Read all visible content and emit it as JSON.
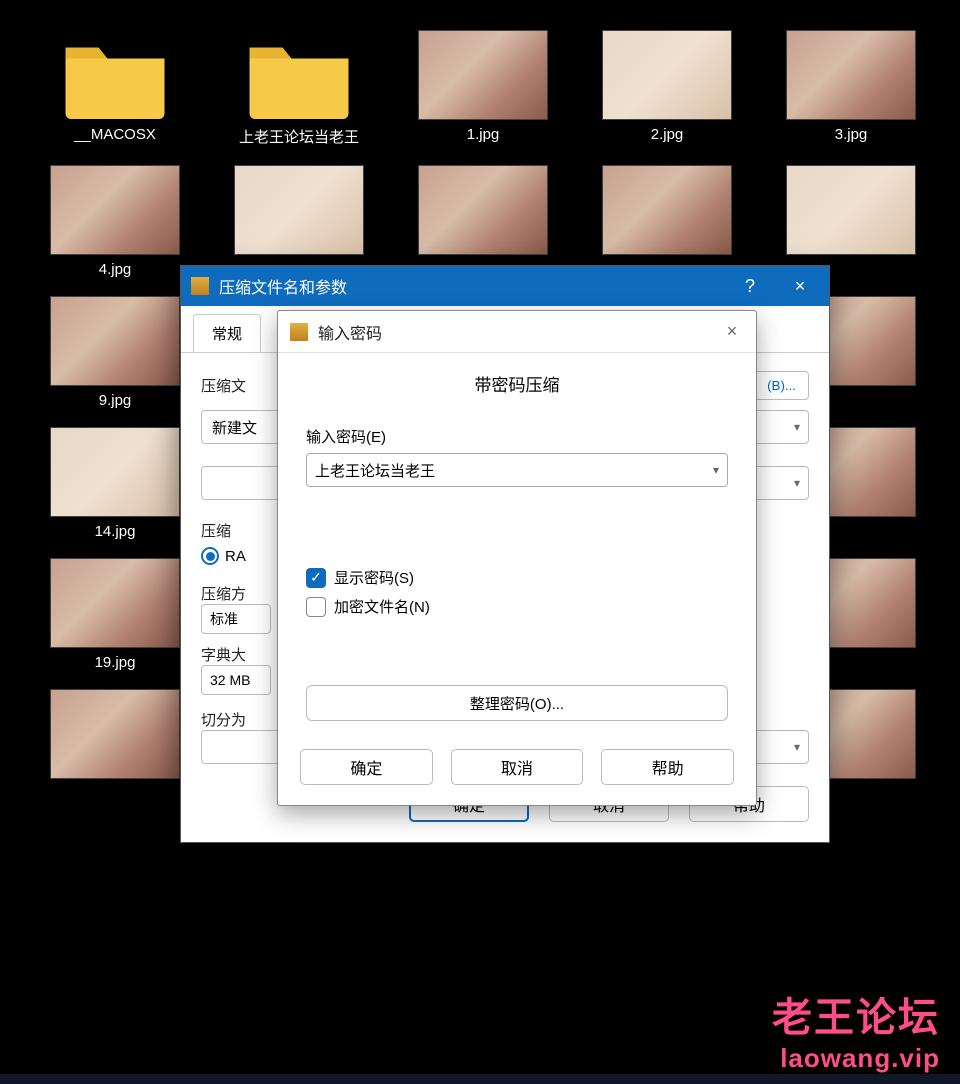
{
  "files": [
    {
      "name": "__MACOSX",
      "type": "folder"
    },
    {
      "name": "上老王论坛当老王",
      "type": "folder"
    },
    {
      "name": "1.jpg",
      "type": "image"
    },
    {
      "name": "2.jpg",
      "type": "image"
    },
    {
      "name": "3.jpg",
      "type": "image"
    },
    {
      "name": "4.jpg",
      "type": "image"
    },
    {
      "name": "",
      "type": "image"
    },
    {
      "name": "",
      "type": "image"
    },
    {
      "name": "",
      "type": "image"
    },
    {
      "name": "",
      "type": "image"
    },
    {
      "name": "9.jpg",
      "type": "image"
    },
    {
      "name": "",
      "type": "image"
    },
    {
      "name": "",
      "type": "image"
    },
    {
      "name": "",
      "type": "image"
    },
    {
      "name": "",
      "type": "image"
    },
    {
      "name": "14.jpg",
      "type": "image"
    },
    {
      "name": "",
      "type": "image"
    },
    {
      "name": "",
      "type": "image"
    },
    {
      "name": "",
      "type": "image"
    },
    {
      "name": "",
      "type": "image"
    },
    {
      "name": "19.jpg",
      "type": "image"
    },
    {
      "name": "",
      "type": "image"
    },
    {
      "name": "",
      "type": "image"
    },
    {
      "name": "",
      "type": "image"
    },
    {
      "name": "",
      "type": "image"
    },
    {
      "name": "",
      "type": "image"
    },
    {
      "name": "",
      "type": "image"
    },
    {
      "name": "",
      "type": "image"
    },
    {
      "name": "",
      "type": "image"
    },
    {
      "name": "",
      "type": "image"
    }
  ],
  "watermark": {
    "line1": "老王论坛",
    "line2": "laowang.vip"
  },
  "dialog_main": {
    "title": "压缩文件名和参数",
    "help_icon": "?",
    "close_icon": "×",
    "tab_general": "常规",
    "label_archive": "压缩文",
    "archive_value": "新建文",
    "browse_label": "(B)...",
    "label_format": "压缩",
    "radio_rar": "RA",
    "label_method": "压缩方",
    "method_value": "标准",
    "label_dict": "字典大",
    "dict_value": "32 MB",
    "label_split": "切分为",
    "btn_ok": "确定",
    "btn_cancel": "取消",
    "btn_help": "帮助"
  },
  "dialog_pw": {
    "title": "输入密码",
    "close_icon": "×",
    "heading": "带密码压缩",
    "field_label": "输入密码(E)",
    "password_value": "上老王论坛当老王",
    "show_password": "显示密码(S)",
    "show_password_checked": true,
    "encrypt_names": "加密文件名(N)",
    "encrypt_names_checked": false,
    "manage_btn": "整理密码(O)...",
    "btn_ok": "确定",
    "btn_cancel": "取消",
    "btn_help": "帮助"
  }
}
